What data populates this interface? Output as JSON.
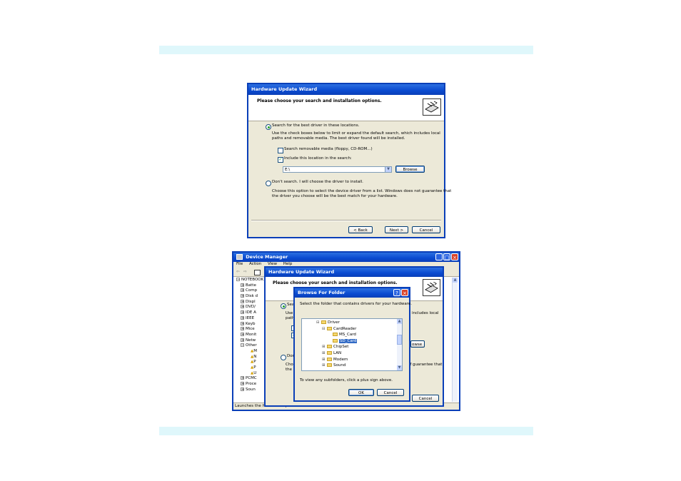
{
  "wizard1": {
    "title": "Hardware Update Wizard",
    "header": "Please choose your search and installation options.",
    "radio_search": "Search for the best driver in these locations.",
    "search_desc1": "Use the check boxes below to limit or expand the default search, which includes local",
    "search_desc2": "paths and removable media. The best driver found will be installed.",
    "check_removable": "Search removable media (floppy, CD-ROM...)",
    "check_include": "Include this location in the search:",
    "location_value": "E:\\",
    "browse": "Browse",
    "radio_dont": "Don't search. I will choose the driver to install.",
    "dont_desc1": "Choose this option to select the device driver from a list. Windows does not guarantee that",
    "dont_desc2": "the driver you choose will be the best match for your hardware.",
    "back": "< Back",
    "next": "Next >",
    "cancel": "Cancel"
  },
  "devmgr": {
    "title": "Device Manager",
    "menu": [
      "File",
      "Action",
      "View",
      "Help"
    ],
    "tree": [
      "NOTEBOOK",
      "Batte",
      "Comp",
      "Disk d",
      "Displ",
      "DVD/",
      "IDE A",
      "IEEE",
      "Keyb",
      "Mice",
      "Monit",
      "Netw",
      "Other",
      "M",
      "N",
      "P",
      "P",
      "U",
      "PCMC",
      "Proce",
      "Soun"
    ],
    "status": "Launches the Hardware Update Wizard for the selected device."
  },
  "wizard2": {
    "title": "Hardware Update Wizard",
    "header": "Please choose your search and installation options.",
    "radio_search_partial": "Sea",
    "use_partial": "Use",
    "paths_partial": "path",
    "includes_local": "includes local",
    "browse_partial": "owse",
    "radio_dont_partial": "Don",
    "choose_partial": "Choo",
    "the_partial": "the d",
    "guarantee_partial": "of guarantee that",
    "cancel": "Cancel"
  },
  "browse_folder": {
    "title": "Browse For Folder",
    "instruction": "Select the folder that contains drivers for your hardware.",
    "tree": [
      {
        "label": "Driver",
        "expander": "⊟",
        "level": 0
      },
      {
        "label": "CardReader",
        "expander": "⊟",
        "level": 1
      },
      {
        "label": "MS_Card",
        "expander": "",
        "level": 2
      },
      {
        "label": "SD_Card",
        "expander": "",
        "level": 2,
        "selected": true
      },
      {
        "label": "ChipSet",
        "expander": "⊞",
        "level": 1
      },
      {
        "label": "LAN",
        "expander": "⊞",
        "level": 1
      },
      {
        "label": "Modem",
        "expander": "⊞",
        "level": 1
      },
      {
        "label": "Sound",
        "expander": "⊞",
        "level": 1
      }
    ],
    "hint": "To view any subfolders, click a plus sign above.",
    "ok": "OK",
    "cancel": "Cancel",
    "help_glyph": "?",
    "close_glyph": "×"
  },
  "colors": {
    "band": "#dff7fb",
    "xp_blue": "#0a4ad0",
    "dialog_bg": "#ece9d8",
    "selection": "#316ac5"
  }
}
